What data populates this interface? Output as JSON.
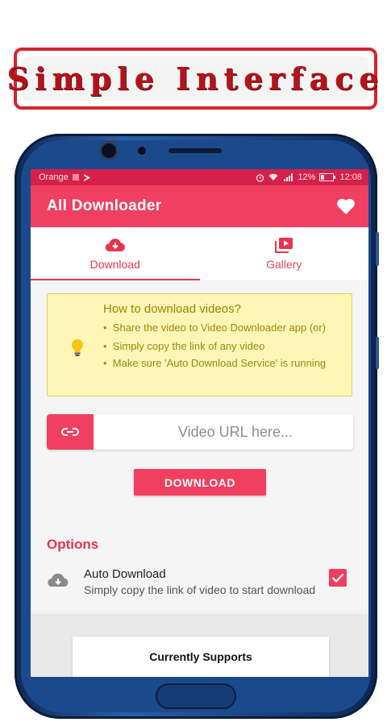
{
  "banner": {
    "text": "Simple Interface"
  },
  "status_bar": {
    "carrier": "Orange",
    "battery": "12%",
    "time": "12:08"
  },
  "app_bar": {
    "title": "All Downloader"
  },
  "tabs": [
    {
      "label": "Download",
      "icon": "cloud-download-icon",
      "active": true
    },
    {
      "label": "Gallery",
      "icon": "video-library-icon",
      "active": false
    }
  ],
  "info_card": {
    "title": "How to download videos?",
    "items": [
      "Share the video to Video Downloader app (or)",
      "Simply copy the link of any video",
      "Make sure 'Auto Download Service' is running"
    ]
  },
  "url_input": {
    "placeholder": "Video URL here..."
  },
  "download_button": {
    "label": "DOWNLOAD"
  },
  "options": {
    "heading": "Options",
    "auto_download": {
      "title": "Auto Download",
      "description": "Simply copy the link of video to start download",
      "checked": true
    }
  },
  "supports": {
    "title": "Currently Supports"
  },
  "colors": {
    "primary": "#f03f60",
    "status_bar": "#d5204a",
    "info_bg": "#fdf6b6",
    "banner_red": "#d8232b"
  }
}
